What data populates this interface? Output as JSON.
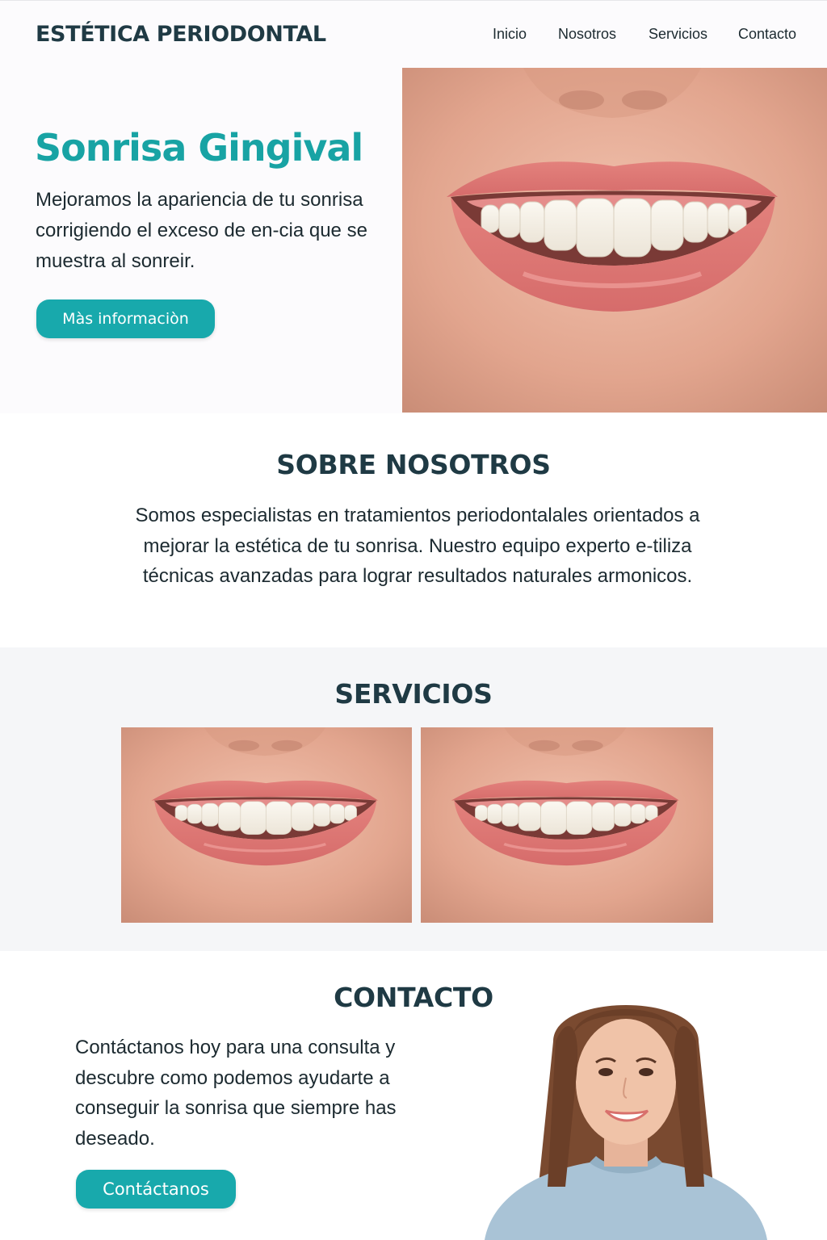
{
  "header": {
    "brand": "ESTÉTICA PERIODONTAL",
    "nav": {
      "inicio": "Inicio",
      "nosotros": "Nosotros",
      "servicios": "Servicios",
      "contacto": "Contacto"
    }
  },
  "hero": {
    "title": "Sonrisa Gingival",
    "text": "Mejoramos la apariencia de tu sonrisa corrigiendo el exceso de en-cia que se muestra al sonreir.",
    "button": "Màs informaciòn",
    "image": "smile-closeup-photo"
  },
  "about": {
    "title": "SOBRE NOSOTROS",
    "text": "Somos especialistas en tratamientos periodontalales orientados a mejorar la estética de tu sonrisa. Nuestro equipo experto e-tiliza técnicas avanzadas para lograr resultados naturales armonicos."
  },
  "services": {
    "title": "SERVICIOS",
    "images": [
      "smile-before-photo",
      "smile-after-photo"
    ]
  },
  "contact": {
    "title": "CONTACTO",
    "text": "Contáctanos hoy para una consulta y descubre como podemos ayudarte a conseguir la sonrisa que siempre has deseado.",
    "button": "Contáctanos",
    "image": "smiling-woman-photo"
  },
  "colors": {
    "accent": "#18a9ac",
    "heading": "#1f3a44",
    "services_bg": "#f5f6f8"
  }
}
